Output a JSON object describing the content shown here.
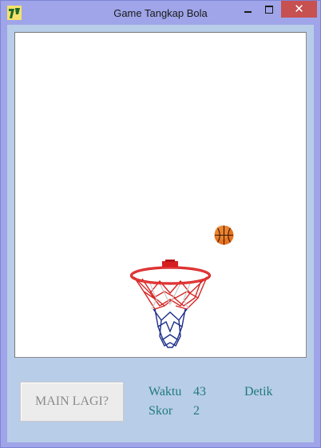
{
  "window": {
    "title": "Game Tangkap Bola",
    "controls": {
      "minimize_icon": "minimize-icon",
      "maximize_icon": "maximize-icon",
      "close_icon": "close-icon",
      "close_glyph": "✕"
    }
  },
  "game": {
    "ball_icon": "basketball-icon",
    "hoop_icon": "basketball-hoop-icon"
  },
  "controls": {
    "play_again_label": "MAIN LAGI?"
  },
  "status": {
    "time_label": "Waktu",
    "time_value": "43",
    "time_unit": "Detik",
    "score_label": "Skor",
    "score_value": "2"
  },
  "colors": {
    "frame": "#9fa5e8",
    "panel": "#b8cde8",
    "status_text": "#1f7b7b",
    "close_button": "#c75050"
  }
}
